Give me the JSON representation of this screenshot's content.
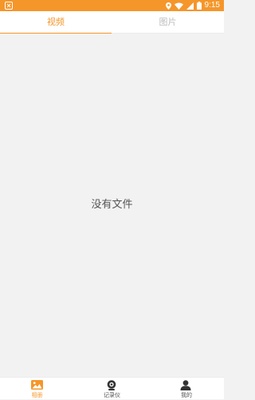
{
  "status_bar": {
    "time": "9:15",
    "background_color": "#f5962a",
    "icons": [
      "android-notification-icon",
      "location-icon",
      "wifi-icon",
      "signal-icon",
      "battery-icon"
    ]
  },
  "tabs": [
    {
      "label": "视频",
      "active": true
    },
    {
      "label": "图片",
      "active": false
    }
  ],
  "accent_color": "#f5962a",
  "content": {
    "empty_message": "没有文件"
  },
  "bottom_nav": [
    {
      "label": "相册",
      "icon": "album-icon",
      "active": true
    },
    {
      "label": "记录仪",
      "icon": "dashcam-icon",
      "active": false
    },
    {
      "label": "我的",
      "icon": "person-icon",
      "active": false
    }
  ]
}
